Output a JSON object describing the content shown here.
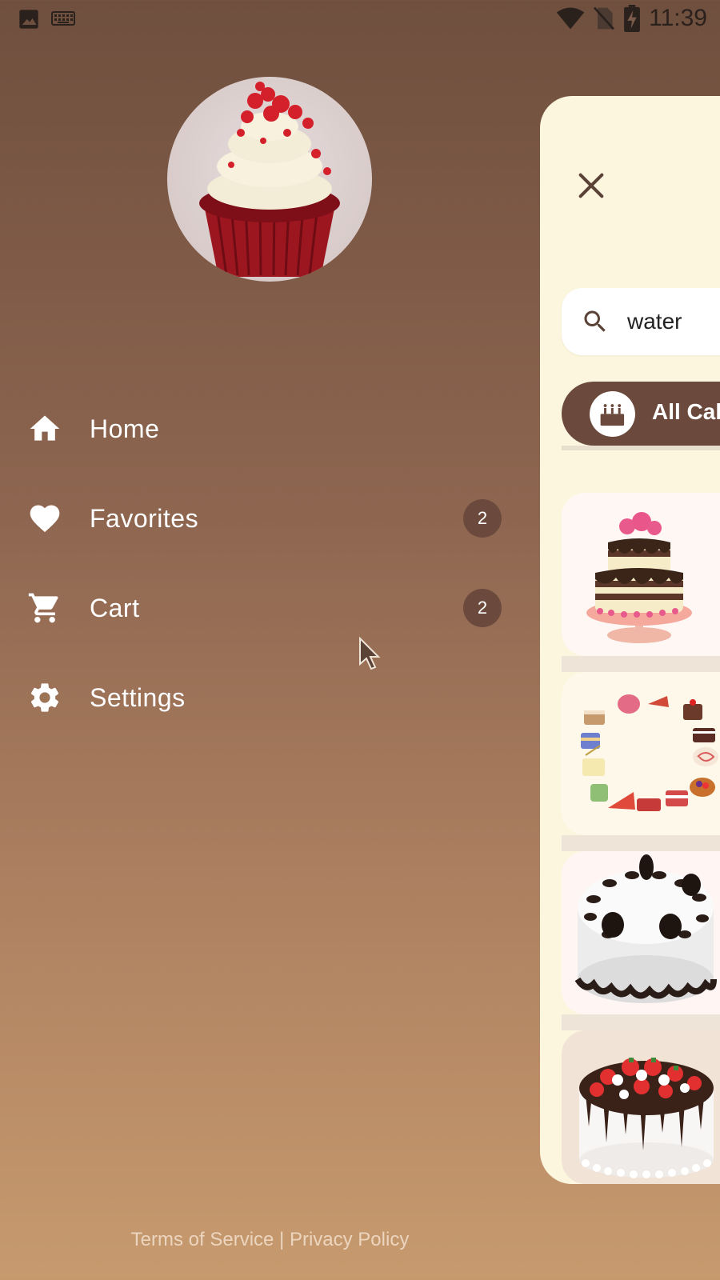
{
  "status_bar": {
    "time": "11:39",
    "icons": [
      "image-icon",
      "keyboard-icon",
      "wifi-icon",
      "no-sim-icon",
      "battery-charging-icon"
    ]
  },
  "drawer": {
    "avatar": "cupcake-avatar",
    "menu": [
      {
        "label": "Home",
        "icon": "home-icon"
      },
      {
        "label": "Favorites",
        "icon": "heart-icon",
        "badge": "2"
      },
      {
        "label": "Cart",
        "icon": "cart-icon",
        "badge": "2"
      },
      {
        "label": "Settings",
        "icon": "gear-icon"
      }
    ],
    "footer": {
      "terms": "Terms of Service",
      "separator": "|",
      "privacy": "Privacy Policy"
    }
  },
  "panel": {
    "close_icon": "close-icon",
    "search": {
      "value": "water",
      "icon": "search-icon"
    },
    "category": {
      "label": "All Cakes",
      "icon": "cake-icon"
    },
    "products": [
      "tiered-chocolate-cake",
      "pastry-wreath",
      "oreo-cake",
      "strawberry-chocolate-cake"
    ]
  },
  "colors": {
    "accent": "#6b4a3d",
    "panel_bg": "#fdf6df",
    "drawer_top": "#6f4f3e",
    "drawer_bottom": "#c79a6e"
  }
}
